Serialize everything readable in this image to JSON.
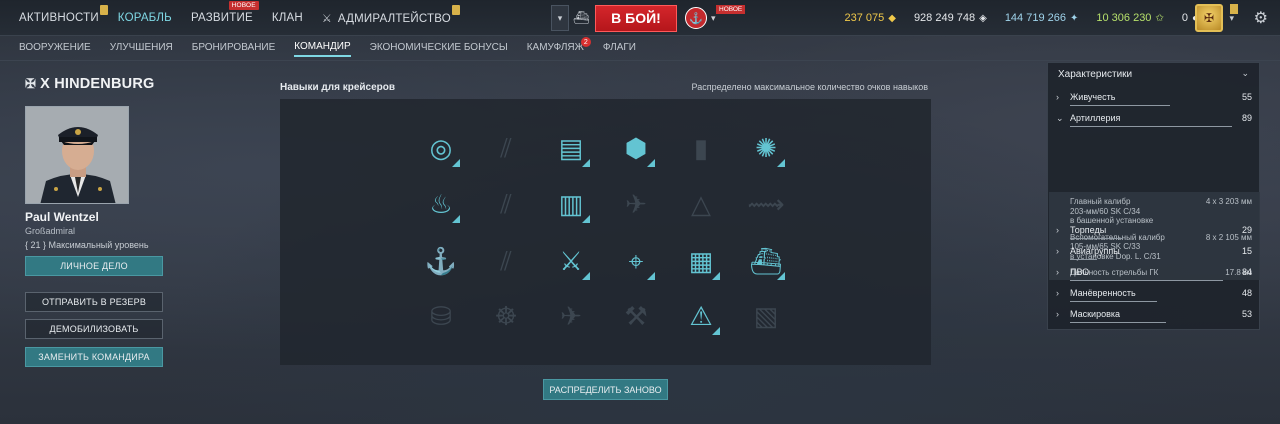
{
  "nav": {
    "items": [
      {
        "label": "АКТИВНОСТИ"
      },
      {
        "label": "КОРАБЛЬ"
      },
      {
        "label": "РАЗВИТИЕ",
        "badge": "НОВОЕ"
      },
      {
        "label": "КЛАН"
      },
      {
        "label": "АДМИРАЛТЕЙСТВО"
      }
    ]
  },
  "battle": {
    "button_label": "В БОЙ!",
    "mode_badge": "НОВОЕ"
  },
  "resources": {
    "doubloons": "237 075",
    "credits": "928 249 748",
    "free_xp": "144 719 266",
    "elite_xp": "10 306 230",
    "coal": "0"
  },
  "subnav": {
    "items": [
      {
        "label": "ВООРУЖЕНИЕ"
      },
      {
        "label": "УЛУЧШЕНИЯ"
      },
      {
        "label": "БРОНИРОВАНИЕ"
      },
      {
        "label": "КОМАНДИР"
      },
      {
        "label": "ЭКОНОМИЧЕСКИЕ БОНУСЫ"
      },
      {
        "label": "КАМУФЛЯЖ",
        "count": "2"
      },
      {
        "label": "ФЛАГИ"
      }
    ]
  },
  "ship": {
    "title": "X HINDENBURG"
  },
  "commander": {
    "name": "Paul Wentzel",
    "rank": "Großadmiral",
    "level": "{ 21 } Максимальный уровень",
    "buttons": {
      "personal_file": "ЛИЧНОЕ ДЕЛО",
      "reserve": "ОТПРАВИТЬ В РЕЗЕРВ",
      "demobilize": "ДЕМОБИЛИЗОВАТЬ",
      "replace": "ЗАМЕНИТЬ КОМАНДИРА"
    }
  },
  "skills": {
    "heading": "Навыки для крейсеров",
    "status": "Распределено максимальное количество очков навыков",
    "redistribute_label": "РАСПРЕДЕЛИТЬ ЗАНОВО",
    "accent": "#63c4d2",
    "grid": [
      [
        {
          "icon": "priority-target-icon",
          "learned": true
        },
        {
          "icon": "shells-dim-icon",
          "learned": false
        },
        {
          "icon": "ammo-belt-icon",
          "learned": true
        },
        {
          "icon": "shell-swap-icon",
          "learned": true
        },
        {
          "icon": "bullet-dim-icon",
          "learned": false
        },
        {
          "icon": "repair-team-icon",
          "learned": true
        }
      ],
      [
        {
          "icon": "fire-icon",
          "learned": true
        },
        {
          "icon": "shells-dim-icon",
          "learned": false
        },
        {
          "icon": "ammo-stack-icon",
          "learned": true
        },
        {
          "icon": "aircraft-dim-icon",
          "learned": false
        },
        {
          "icon": "warning-dim-icon",
          "learned": false
        },
        {
          "icon": "torpedo-dim-icon",
          "learned": false
        }
      ],
      [
        {
          "icon": "anchor-dim-icon",
          "learned": false
        },
        {
          "icon": "shells-dim-icon",
          "learned": false
        },
        {
          "icon": "crossed-swords-icon",
          "learned": true
        },
        {
          "icon": "radio-location-icon",
          "learned": true
        },
        {
          "icon": "armor-plate-icon",
          "learned": true
        },
        {
          "icon": "ship-silhouette-icon",
          "learned": true
        }
      ],
      [
        {
          "icon": "barrel-dim-icon",
          "learned": false
        },
        {
          "icon": "helm-dim-icon",
          "learned": false
        },
        {
          "icon": "plane-dim-icon",
          "learned": false
        },
        {
          "icon": "wrench-dim-icon",
          "learned": false
        },
        {
          "icon": "alert-icon",
          "learned": true
        },
        {
          "icon": "map-dim-icon",
          "learned": false
        }
      ]
    ]
  },
  "stats": {
    "heading": "Характеристики",
    "rows": [
      {
        "name": "Живучесть",
        "value": "55",
        "level": 0.55,
        "expanded": false
      },
      {
        "name": "Артиллерия",
        "value": "89",
        "level": 0.89,
        "expanded": true
      },
      {
        "name": "Торпеды",
        "value": "29",
        "level": 0.29,
        "expanded": false
      },
      {
        "name": "Авиагруппы",
        "value": "15",
        "level": 0.15,
        "expanded": false
      },
      {
        "name": "ПВО",
        "value": "84",
        "level": 0.84,
        "expanded": false
      },
      {
        "name": "Манёвренность",
        "value": "48",
        "level": 0.48,
        "expanded": false
      },
      {
        "name": "Маскировка",
        "value": "53",
        "level": 0.53,
        "expanded": false
      }
    ],
    "artillery_details": [
      {
        "lines": [
          "Главный калибр",
          "203-мм/60 SK C/34",
          "в башенной установке"
        ],
        "value": "4 x 3  203 мм"
      },
      {
        "lines": [
          "Вспомогательный калибр",
          "105-мм/65 SK C/33",
          "в установке Dop. L. C/31"
        ],
        "value": "8 x 2  105 мм"
      },
      {
        "lines": [
          "Дальность стрельбы ГК"
        ],
        "value": "17.8 км"
      }
    ]
  }
}
